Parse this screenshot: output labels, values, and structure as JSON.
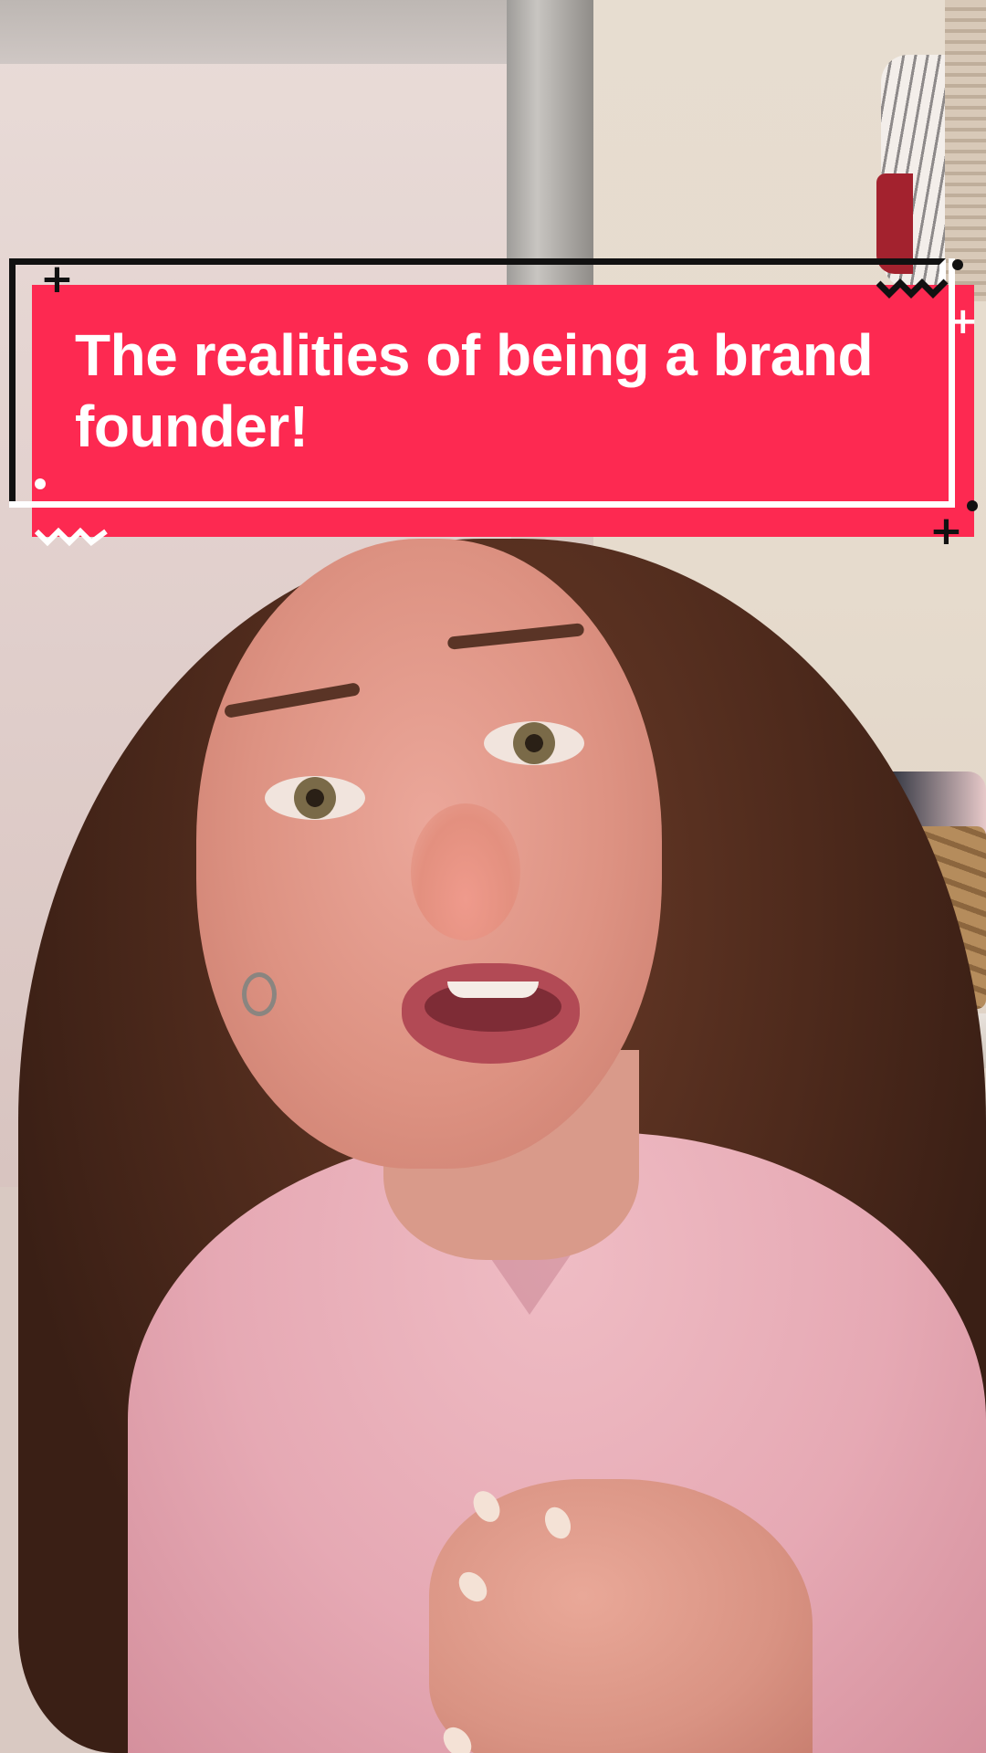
{
  "video": {
    "caption_title": "The realities of being a brand founder!"
  },
  "colors": {
    "banner_fill": "#fd2951",
    "banner_text": "#ffffff",
    "accent_dark": "#111111",
    "accent_light": "#ffffff"
  },
  "icons": {
    "plus_glyph": "+",
    "decor": [
      "plus-icon",
      "dot-icon",
      "zigzag-icon"
    ]
  }
}
